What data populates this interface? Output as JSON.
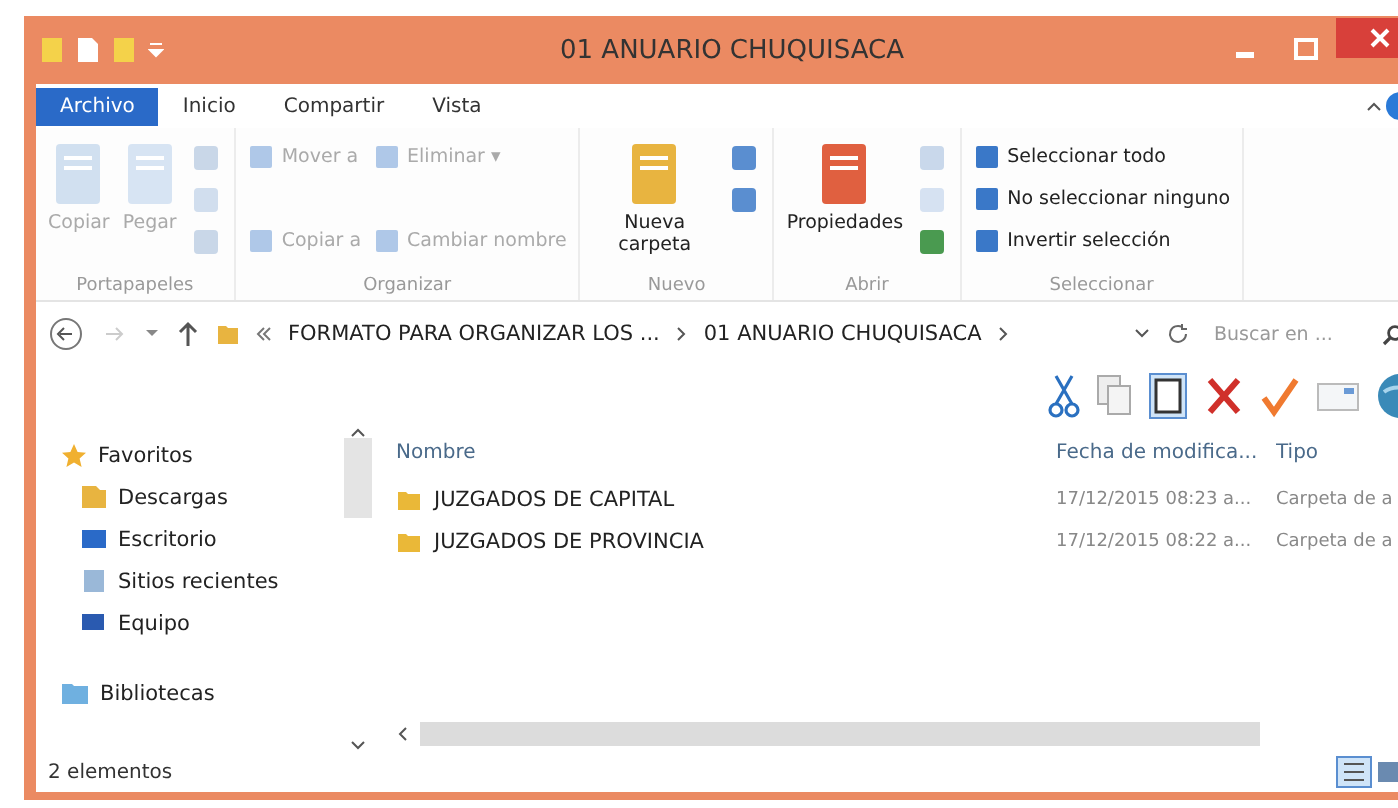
{
  "window": {
    "title": "01 ANUARIO CHUQUISACA"
  },
  "tabs": [
    {
      "label": "Archivo",
      "selected": true
    },
    {
      "label": "Inicio",
      "selected": false
    },
    {
      "label": "Compartir",
      "selected": false
    },
    {
      "label": "Vista",
      "selected": false
    }
  ],
  "ribbon": [
    {
      "name": "Portapapeles",
      "items": [
        {
          "kind": "large",
          "label": "Copiar",
          "disabled": true
        },
        {
          "kind": "large",
          "label": "Pegar",
          "disabled": true
        },
        {
          "kind": "icon",
          "disabled": true
        },
        {
          "kind": "icon",
          "disabled": true
        },
        {
          "kind": "icon",
          "disabled": true
        }
      ]
    },
    {
      "name": "Organizar",
      "items": [
        {
          "kind": "small",
          "label": "Mover a",
          "disabled": true
        },
        {
          "kind": "spacer"
        },
        {
          "kind": "small",
          "label": "Copiar a",
          "disabled": true
        },
        {
          "kind": "small",
          "label": "Eliminar ▾",
          "disabled": true
        },
        {
          "kind": "spacer"
        },
        {
          "kind": "small",
          "label": "Cambiar nombre",
          "disabled": true
        }
      ]
    },
    {
      "name": "Nuevo",
      "items": [
        {
          "kind": "large",
          "label": "Nueva carpeta",
          "disabled": false
        },
        {
          "kind": "icon",
          "disabled": false
        },
        {
          "kind": "icon",
          "disabled": false
        }
      ]
    },
    {
      "name": "Abrir",
      "items": [
        {
          "kind": "large",
          "label": "Propiedades",
          "disabled": false
        },
        {
          "kind": "icon",
          "disabled": true
        },
        {
          "kind": "icon",
          "disabled": true
        },
        {
          "kind": "icon",
          "disabled": false
        }
      ]
    },
    {
      "name": "Seleccionar",
      "items": [
        {
          "kind": "small",
          "label": "Seleccionar todo",
          "disabled": false
        },
        {
          "kind": "small",
          "label": "No seleccionar ninguno",
          "disabled": false
        },
        {
          "kind": "small",
          "label": "Invertir selección",
          "disabled": false
        }
      ]
    }
  ],
  "address": {
    "path": [
      "FORMATO PARA ORGANIZAR LOS ...",
      "01 ANUARIO CHUQUISACA"
    ]
  },
  "search": {
    "placeholder": "Buscar en ..."
  },
  "navigation": [
    {
      "label": "Favoritos",
      "children": [
        {
          "label": "Descargas"
        },
        {
          "label": "Escritorio"
        },
        {
          "label": "Sitios recientes"
        },
        {
          "label": "Equipo"
        }
      ]
    },
    {
      "label": "Bibliotecas"
    }
  ],
  "table": {
    "columns": [
      "Nombre",
      "Fecha de modifica...",
      "Tipo"
    ],
    "rows": [
      {
        "name": "JUZGADOS DE CAPITAL",
        "date": "17/12/2015 08:23 a...",
        "type": "Carpeta de a"
      },
      {
        "name": "JUZGADOS DE PROVINCIA",
        "date": "17/12/2015 08:22 a...",
        "type": "Carpeta de a"
      }
    ]
  },
  "status_bar": "2 elementos"
}
